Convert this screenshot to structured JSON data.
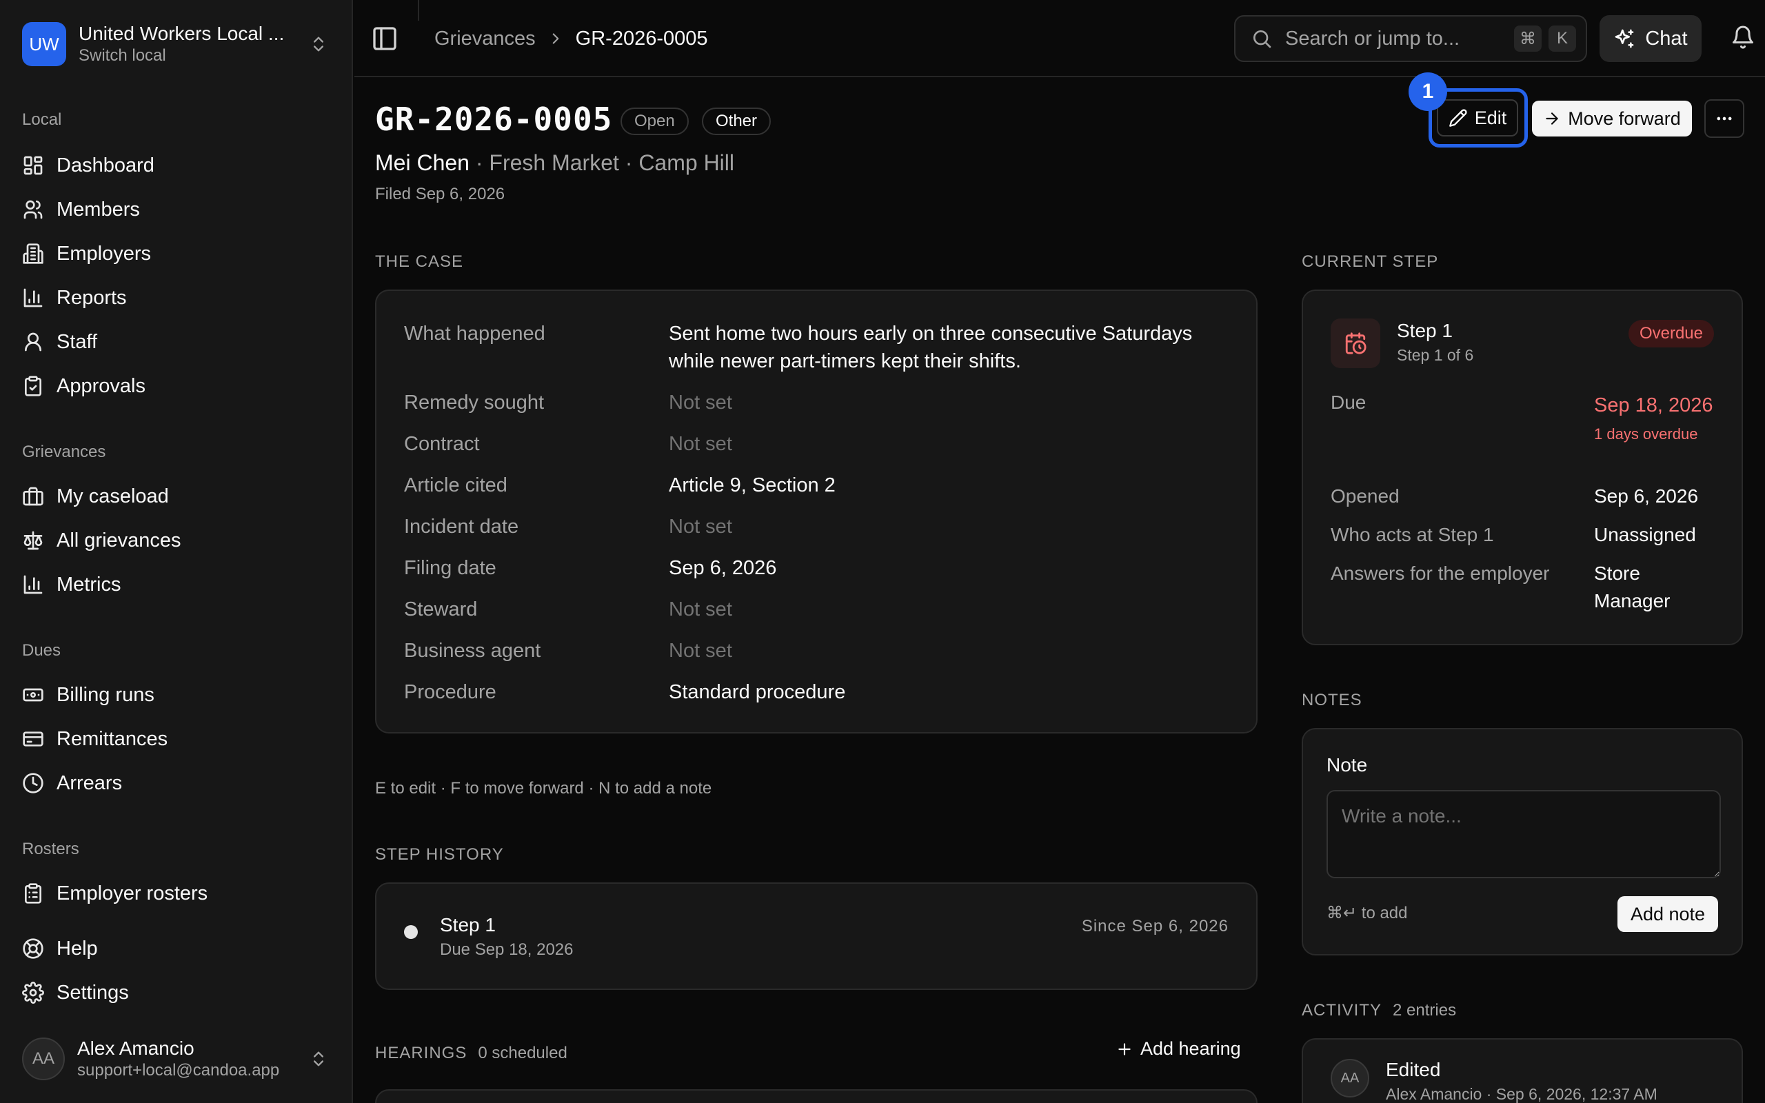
{
  "org": {
    "initials": "UW",
    "name": "United Workers Local ...",
    "subtitle": "Switch local"
  },
  "nav": {
    "local_label": "Local",
    "local": [
      {
        "label": "Dashboard",
        "icon": "dashboard-icon"
      },
      {
        "label": "Members",
        "icon": "users-icon"
      },
      {
        "label": "Employers",
        "icon": "building-icon"
      },
      {
        "label": "Reports",
        "icon": "bar-chart-icon"
      },
      {
        "label": "Staff",
        "icon": "user-icon"
      },
      {
        "label": "Approvals",
        "icon": "clipboard-check-icon"
      }
    ],
    "grievances_label": "Grievances",
    "grievances": [
      {
        "label": "My caseload",
        "icon": "briefcase-icon"
      },
      {
        "label": "All grievances",
        "icon": "scale-icon"
      },
      {
        "label": "Metrics",
        "icon": "bar-chart-icon"
      }
    ],
    "dues_label": "Dues",
    "dues": [
      {
        "label": "Billing runs",
        "icon": "banknote-icon"
      },
      {
        "label": "Remittances",
        "icon": "wallet-icon"
      },
      {
        "label": "Arrears",
        "icon": "clock-icon"
      }
    ],
    "rosters_label": "Rosters",
    "rosters": [
      {
        "label": "Employer rosters",
        "icon": "clipboard-list-icon"
      }
    ],
    "help": "Help",
    "settings": "Settings"
  },
  "user": {
    "initials": "AA",
    "name": "Alex Amancio",
    "email": "support+local@candoa.app"
  },
  "topbar": {
    "breadcrumb": [
      "Grievances",
      "GR-2026-0005"
    ],
    "search_placeholder": "Search or jump to...",
    "search_keys": [
      "⌘",
      "K"
    ],
    "chat_label": "Chat"
  },
  "grievance": {
    "id": "GR-2026-0005",
    "status": "Open",
    "category": "Other",
    "member": "Mei Chen",
    "employer": "Fresh Market",
    "location": "Camp Hill",
    "filed": "Filed Sep 6, 2026"
  },
  "actions": {
    "edit": "Edit",
    "edit_marker": "1",
    "move_forward": "Move forward"
  },
  "case": {
    "heading": "THE CASE",
    "rows": [
      {
        "label": "What happened",
        "value": "Sent home two hours early on three consecutive Saturdays while newer part-timers kept their shifts."
      },
      {
        "label": "Remedy sought",
        "value": "Not set"
      },
      {
        "label": "Contract",
        "value": "Not set"
      },
      {
        "label": "Article cited",
        "value": "Article 9, Section 2"
      },
      {
        "label": "Incident date",
        "value": "Not set"
      },
      {
        "label": "Filing date",
        "value": "Sep 6, 2026"
      },
      {
        "label": "Steward",
        "value": "Not set"
      },
      {
        "label": "Business agent",
        "value": "Not set"
      },
      {
        "label": "Procedure",
        "value": "Standard procedure"
      }
    ]
  },
  "shortcut_hint": "E to edit · F to move forward · N to add a note",
  "history": {
    "heading": "STEP HISTORY",
    "step": "Step 1",
    "due": "Due Sep 18, 2026",
    "since": "Since Sep 6, 2026"
  },
  "hearings": {
    "heading": "HEARINGS",
    "count": "0 scheduled",
    "add_label": "Add hearing"
  },
  "current_step": {
    "heading": "CURRENT STEP",
    "name": "Step 1",
    "of": "Step 1 of 6",
    "badge": "Overdue",
    "due_label": "Due",
    "due_date": "Sep 18, 2026",
    "due_overdue": "1 days overdue",
    "opened_label": "Opened",
    "opened_value": "Sep 6, 2026",
    "who_label": "Who acts at Step 1",
    "who_value": "Unassigned",
    "answers_label": "Answers for the employer",
    "answers_value": "Store Manager"
  },
  "notes": {
    "heading": "NOTES",
    "label": "Note",
    "placeholder": "Write a note...",
    "hint": "⌘↵ to add",
    "add_label": "Add note"
  },
  "activity": {
    "heading": "ACTIVITY",
    "count": "2 entries",
    "items": [
      {
        "initials": "AA",
        "title": "Edited",
        "meta": "Alex Amancio · Sep 6, 2026, 12:37 AM"
      }
    ]
  },
  "colors": {
    "background": "#0a0a0a",
    "sidebar": "#171717",
    "accent": "#2563eb",
    "overdue": "#f87171",
    "muted_text": "#a3a3a3"
  }
}
